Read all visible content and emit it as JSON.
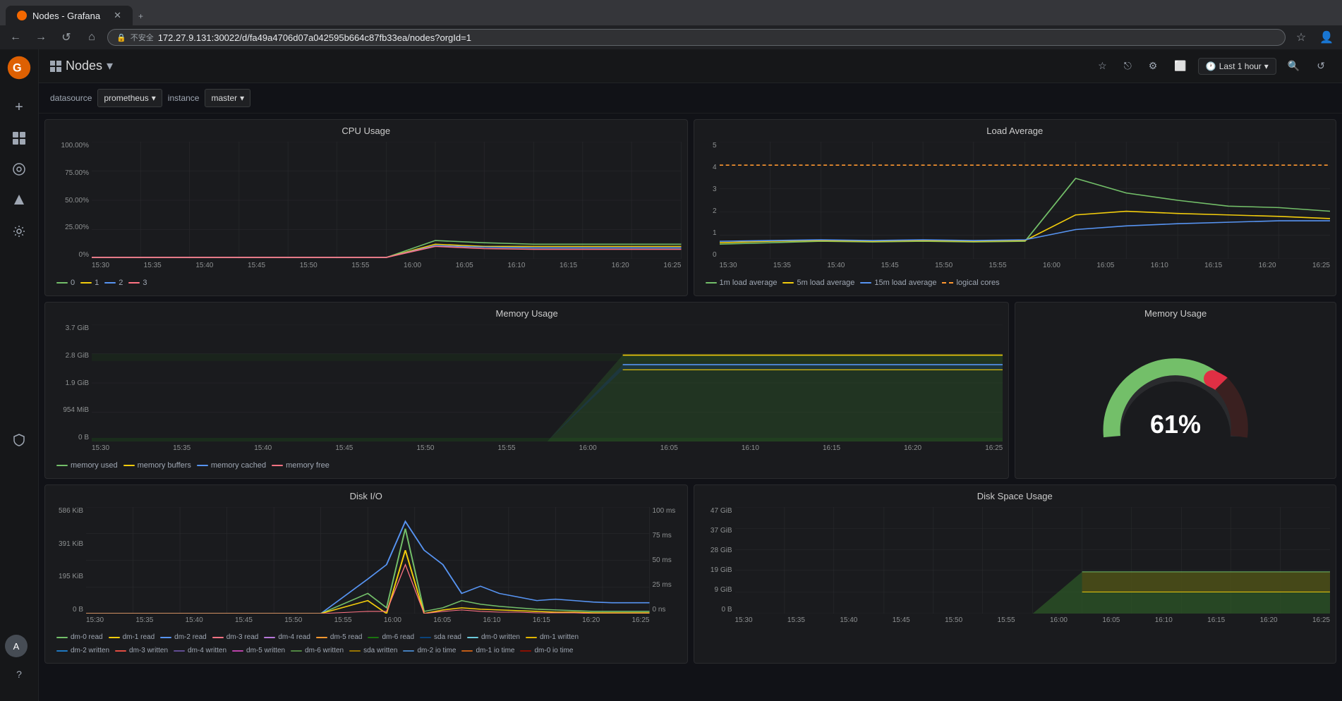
{
  "browser": {
    "tab_title": "Nodes - Grafana",
    "url": "172.27.9.131:30022/d/fa49a4706d07a042595b664c87fb33ea/nodes?orgId=1",
    "insecure_label": "不安全"
  },
  "app": {
    "title": "Nodes",
    "title_dropdown": "▾"
  },
  "toolbar": {
    "datasource_label": "datasource",
    "prometheus_label": "prometheus",
    "instance_label": "instance",
    "master_label": "master"
  },
  "time_range": {
    "label": "Last 1 hour"
  },
  "panels": {
    "cpu_usage": {
      "title": "CPU Usage",
      "y_axis": [
        "100.00%",
        "75.00%",
        "50.00%",
        "25.00%",
        "0%"
      ],
      "x_axis": [
        "15:30",
        "15:35",
        "15:40",
        "15:45",
        "15:50",
        "15:55",
        "16:00",
        "16:05",
        "16:10",
        "16:15",
        "16:20",
        "16:25"
      ],
      "legend": [
        {
          "label": "0",
          "color": "#73bf69"
        },
        {
          "label": "1",
          "color": "#f2cc0c"
        },
        {
          "label": "2",
          "color": "#5794f2"
        },
        {
          "label": "3",
          "color": "#ff7383"
        }
      ]
    },
    "load_average": {
      "title": "Load Average",
      "y_axis": [
        "5",
        "4",
        "3",
        "2",
        "1",
        "0"
      ],
      "x_axis": [
        "15:30",
        "15:35",
        "15:40",
        "15:45",
        "15:50",
        "15:55",
        "16:00",
        "16:05",
        "16:10",
        "16:15",
        "16:20",
        "16:25"
      ],
      "legend": [
        {
          "label": "1m load average",
          "color": "#73bf69"
        },
        {
          "label": "5m load average",
          "color": "#f2cc0c"
        },
        {
          "label": "15m load average",
          "color": "#5794f2"
        },
        {
          "label": "logical cores",
          "color": "#ff9830"
        }
      ]
    },
    "memory_usage_chart": {
      "title": "Memory Usage",
      "y_axis": [
        "3.7 GiB",
        "2.8 GiB",
        "1.9 GiB",
        "954 MiB",
        "0 B"
      ],
      "x_axis": [
        "15:30",
        "15:35",
        "15:40",
        "15:45",
        "15:50",
        "15:55",
        "16:00",
        "16:05",
        "16:10",
        "16:15",
        "16:20",
        "16:25",
        "16:25"
      ],
      "legend": [
        {
          "label": "memory used",
          "color": "#73bf69"
        },
        {
          "label": "memory buffers",
          "color": "#f2cc0c"
        },
        {
          "label": "memory cached",
          "color": "#5794f2"
        },
        {
          "label": "memory free",
          "color": "#ff7383"
        }
      ]
    },
    "memory_gauge": {
      "title": "Memory Usage",
      "value": "61%",
      "percentage": 61
    },
    "disk_io": {
      "title": "Disk I/O",
      "y_axis_left": [
        "586 KiB",
        "391 KiB",
        "195 KiB",
        "0 B"
      ],
      "y_axis_right": [
        "100 ms",
        "75 ms",
        "50 ms",
        "25 ms",
        "0 ns"
      ],
      "x_axis": [
        "15:30",
        "15:35",
        "15:40",
        "15:45",
        "15:50",
        "15:55",
        "16:00",
        "16:05",
        "16:10",
        "16:15",
        "16:20",
        "16:25"
      ],
      "legend_row1": [
        {
          "label": "dm-0 read",
          "color": "#73bf69"
        },
        {
          "label": "dm-1 read",
          "color": "#f2cc0c"
        },
        {
          "label": "dm-2 read",
          "color": "#5794f2"
        },
        {
          "label": "dm-3 read",
          "color": "#ff7383"
        },
        {
          "label": "dm-4 read",
          "color": "#b877d9"
        },
        {
          "label": "dm-5 read",
          "color": "#ff9830"
        },
        {
          "label": "dm-6 read",
          "color": "#19730e"
        },
        {
          "label": "sda read",
          "color": "#0a437c"
        },
        {
          "label": "dm-0 written",
          "color": "#6ccadc"
        },
        {
          "label": "dm-1 written",
          "color": "#e0b400"
        }
      ],
      "legend_row2": [
        {
          "label": "dm-2 written",
          "color": "#1f78c1"
        },
        {
          "label": "dm-3 written",
          "color": "#e24d42"
        },
        {
          "label": "dm-4 written",
          "color": "#614d93"
        },
        {
          "label": "dm-5 written",
          "color": "#ba43a9"
        },
        {
          "label": "dm-6 written",
          "color": "#508642"
        },
        {
          "label": "sda written",
          "color": "#967302"
        },
        {
          "label": "dm-2 io time",
          "color": "#447ebc"
        },
        {
          "label": "dm-1 io time",
          "color": "#c15c17"
        },
        {
          "label": "dm-0 io time",
          "color": "#890f02"
        }
      ]
    },
    "disk_space": {
      "title": "Disk Space Usage",
      "y_axis": [
        "47 GiB",
        "37 GiB",
        "28 GiB",
        "19 GiB",
        "9 GiB",
        "0 B"
      ],
      "x_axis": [
        "15:30",
        "15:35",
        "15:40",
        "15:45",
        "15:50",
        "15:55",
        "16:00",
        "16:05",
        "16:10",
        "16:15",
        "16:20",
        "16:25"
      ]
    }
  },
  "sidebar": {
    "items": [
      {
        "name": "plus",
        "icon": "+"
      },
      {
        "name": "grid",
        "icon": "⊞"
      },
      {
        "name": "compass",
        "icon": "◎"
      },
      {
        "name": "bell",
        "icon": "🔔"
      },
      {
        "name": "gear",
        "icon": "⚙"
      },
      {
        "name": "shield",
        "icon": "🛡"
      }
    ],
    "avatar_initials": "A"
  }
}
